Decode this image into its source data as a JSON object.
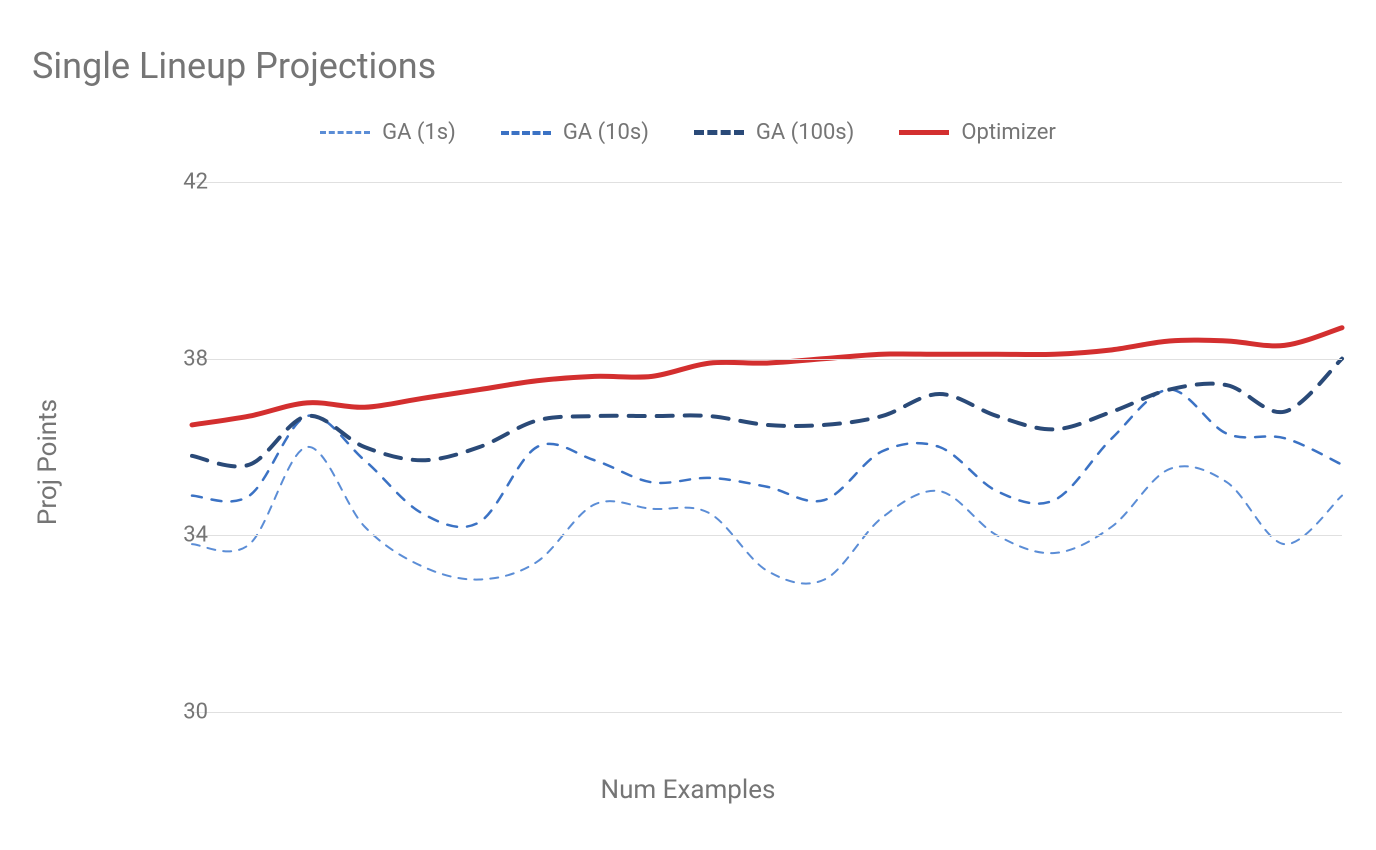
{
  "chart_data": {
    "type": "line",
    "title": "Single Lineup Projections",
    "xlabel": "Num Examples",
    "ylabel": "Proj Points",
    "ylim": [
      30,
      42
    ],
    "yticks": [
      30,
      34,
      38,
      42
    ],
    "x": [
      1,
      2,
      3,
      4,
      5,
      6,
      7,
      8,
      9,
      10,
      11,
      12,
      13,
      14,
      15,
      16,
      17,
      18,
      19,
      20,
      21
    ],
    "series": [
      {
        "name": "GA (1s)",
        "color": "#5b8dd6",
        "style": "dash-thin",
        "stroke_width": 2,
        "dash": "8 8",
        "values": [
          33.8,
          33.8,
          36.0,
          34.2,
          33.3,
          33.0,
          33.4,
          34.7,
          34.6,
          34.5,
          33.2,
          33.0,
          34.4,
          35.0,
          34.0,
          33.6,
          34.2,
          35.5,
          35.2,
          33.8,
          34.9
        ]
      },
      {
        "name": "GA (10s)",
        "color": "#3b72c4",
        "style": "dash-med",
        "stroke_width": 2.5,
        "dash": "10 10",
        "values": [
          34.9,
          34.9,
          36.7,
          35.7,
          34.5,
          34.3,
          36.0,
          35.7,
          35.2,
          35.3,
          35.1,
          34.8,
          35.9,
          36.0,
          35.0,
          34.8,
          36.2,
          37.3,
          36.3,
          36.2,
          35.6
        ]
      },
      {
        "name": "GA (100s)",
        "color": "#2a4a78",
        "style": "dash-thick",
        "stroke_width": 4,
        "dash": "16 12",
        "values": [
          35.8,
          35.6,
          36.7,
          36.0,
          35.7,
          36.0,
          36.6,
          36.7,
          36.7,
          36.7,
          36.5,
          36.5,
          36.7,
          37.2,
          36.7,
          36.4,
          36.8,
          37.3,
          37.4,
          36.8,
          38.0
        ]
      },
      {
        "name": "Optimizer",
        "color": "#d32f2f",
        "style": "solid",
        "stroke_width": 5,
        "dash": null,
        "values": [
          36.5,
          36.7,
          37.0,
          36.9,
          37.1,
          37.3,
          37.5,
          37.6,
          37.6,
          37.9,
          37.9,
          38.0,
          38.1,
          38.1,
          38.1,
          38.1,
          38.2,
          38.4,
          38.4,
          38.3,
          38.7
        ]
      }
    ]
  }
}
